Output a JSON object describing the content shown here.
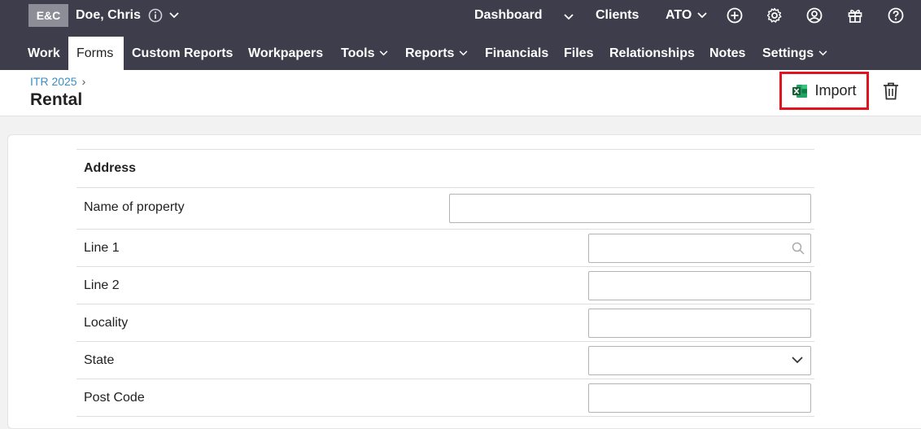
{
  "topbar": {
    "badge": "E&C",
    "client_name": "Doe, Chris",
    "nav": {
      "dashboard": "Dashboard",
      "clients": "Clients",
      "ato": "ATO"
    },
    "icons": [
      "plus-circle-icon",
      "gear-icon",
      "user-circle-icon",
      "gift-icon",
      "help-icon"
    ]
  },
  "menu": {
    "items": [
      {
        "label": "Work",
        "active": false
      },
      {
        "label": "Forms",
        "active": true
      },
      {
        "label": "Custom Reports",
        "active": false
      },
      {
        "label": "Workpapers",
        "active": false
      },
      {
        "label": "Tools",
        "active": false,
        "dropdown": true
      },
      {
        "label": "Reports",
        "active": false,
        "dropdown": true
      },
      {
        "label": "Financials",
        "active": false
      },
      {
        "label": "Files",
        "active": false
      },
      {
        "label": "Relationships",
        "active": false
      },
      {
        "label": "Notes",
        "active": false
      },
      {
        "label": "Settings",
        "active": false,
        "dropdown": true
      }
    ]
  },
  "header": {
    "breadcrumb": "ITR 2025",
    "breadcrumb_sep": "›",
    "title": "Rental",
    "import_label": "Import"
  },
  "form": {
    "section_title": "Address",
    "fields": {
      "name_of_property": {
        "label": "Name of property",
        "value": ""
      },
      "line1": {
        "label": "Line 1",
        "value": ""
      },
      "line2": {
        "label": "Line 2",
        "value": ""
      },
      "locality": {
        "label": "Locality",
        "value": ""
      },
      "state": {
        "label": "State",
        "value": ""
      },
      "post_code": {
        "label": "Post Code",
        "value": ""
      }
    }
  },
  "colors": {
    "topbar_bg": "#3e3d4b",
    "link": "#3b8fc4",
    "highlight": "#e0141e",
    "excel_green": "#1d7044"
  }
}
